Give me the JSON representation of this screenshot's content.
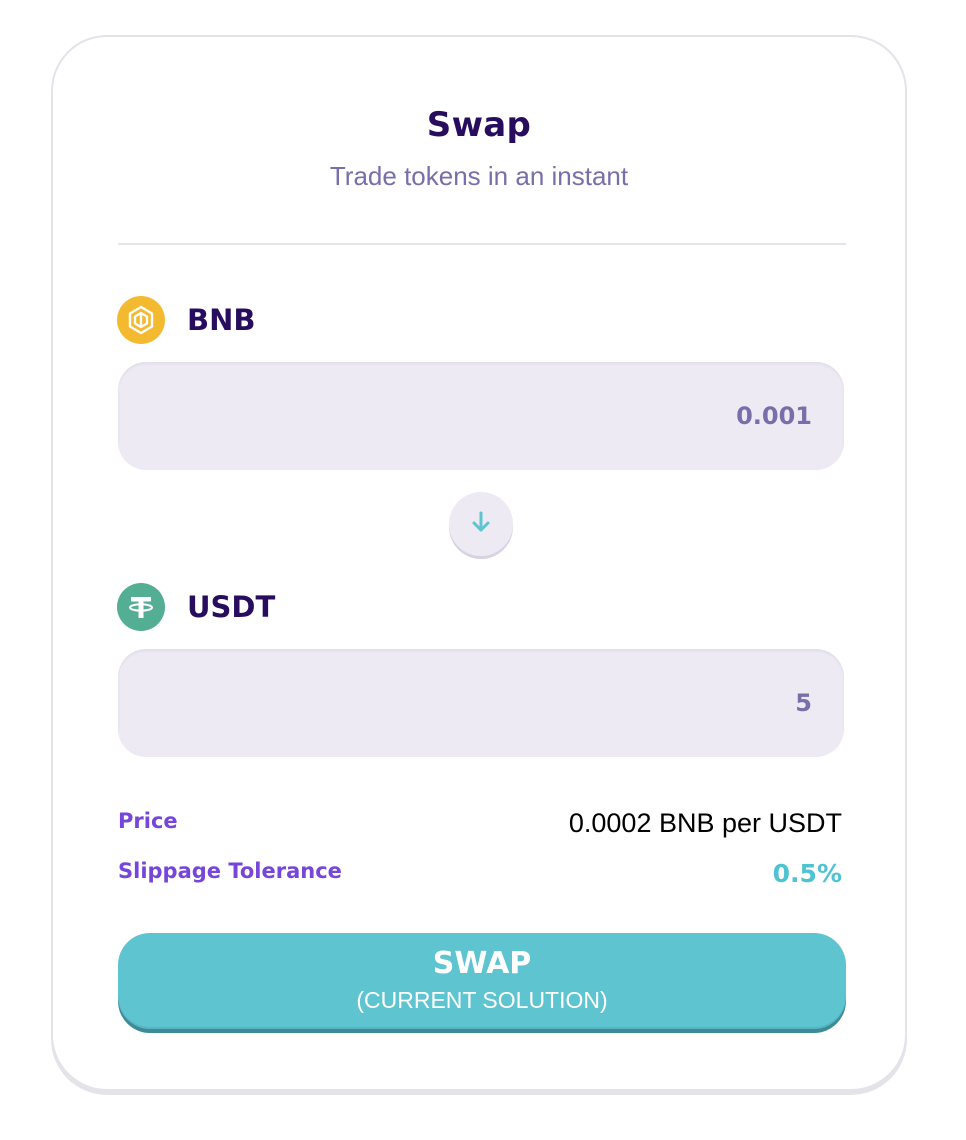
{
  "header": {
    "title": "Swap",
    "subtitle": "Trade tokens in an instant"
  },
  "from_token": {
    "symbol": "BNB",
    "icon": "bnb-icon",
    "amount": "0.001",
    "color": "#f3ba2f"
  },
  "to_token": {
    "symbol": "USDT",
    "icon": "usdt-icon",
    "amount": "5",
    "color": "#53ae94"
  },
  "switch": {
    "icon": "arrow-down-icon"
  },
  "details": {
    "price_label": "Price",
    "price_value": "0.0002 BNB per USDT",
    "slippage_label": "Slippage Tolerance",
    "slippage_value": "0.5%"
  },
  "action": {
    "label": "SWAP",
    "sublabel": "(CURRENT SOLUTION)"
  },
  "colors": {
    "primary_text": "#280d5f",
    "secondary_text": "#7a6eaa",
    "accent": "#5ec4d0",
    "label_purple": "#7645d9",
    "input_bg": "#eeeaf4"
  }
}
